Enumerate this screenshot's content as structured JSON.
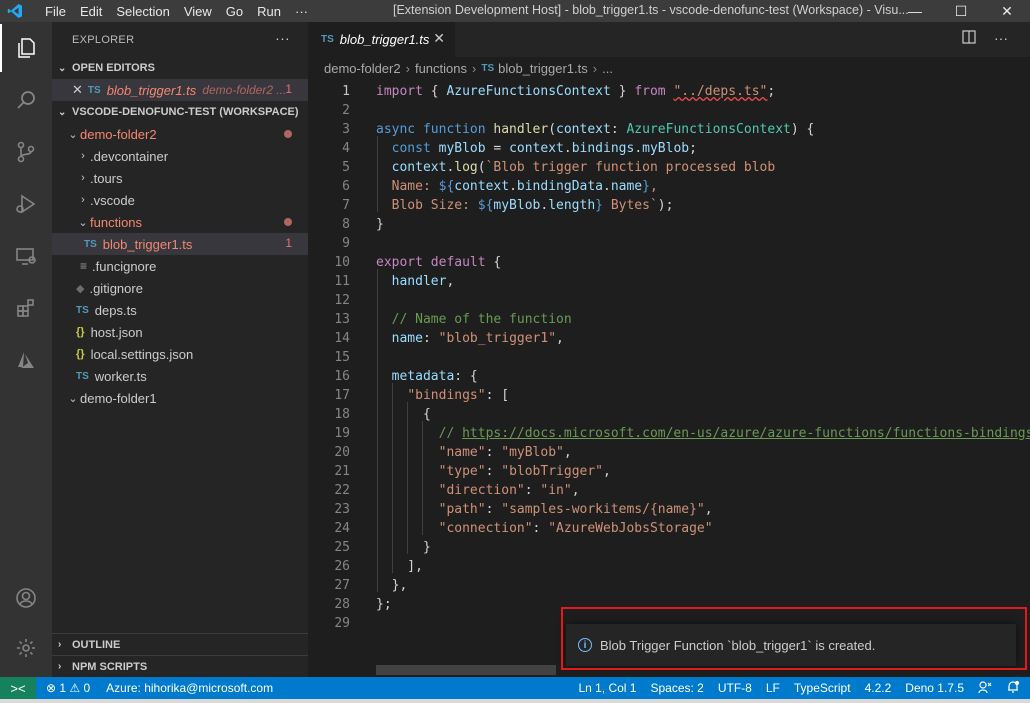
{
  "titlebar": {
    "menu": [
      "File",
      "Edit",
      "Selection",
      "View",
      "Go",
      "Run",
      "···"
    ],
    "window_title": "[Extension Development Host] - blob_trigger1.ts - vscode-denofunc-test (Workspace) - Visu...",
    "minimize": "—",
    "maximize": "☐",
    "close": "✕"
  },
  "sidebar": {
    "title": "EXPLORER",
    "more": "···",
    "open_editors_label": "OPEN EDITORS",
    "open_editor": {
      "name": "blob_trigger1.ts",
      "folder": "demo-folder2 ...",
      "badge": "1"
    },
    "workspace_label": "VSCODE-DENOFUNC-TEST (WORKSPACE)",
    "tree": {
      "demo_folder2": "demo-folder2",
      "devcontainer": ".devcontainer",
      "tours": ".tours",
      "vscode": ".vscode",
      "functions": "functions",
      "blob_trigger": "blob_trigger1.ts",
      "blob_badge": "1",
      "funcignore": ".funcignore",
      "gitignore": ".gitignore",
      "deps": "deps.ts",
      "host": "host.json",
      "local_settings": "local.settings.json",
      "worker": "worker.ts",
      "demo_folder1": "demo-folder1"
    },
    "outline_label": "OUTLINE",
    "npm_label": "NPM SCRIPTS",
    "file_tag": "TS",
    "json_tag": "{}"
  },
  "tabs": {
    "active": "blob_trigger1.ts",
    "close": "✕",
    "tag": "TS"
  },
  "breadcrumb": [
    "demo-folder2",
    "functions",
    "blob_trigger1.ts",
    "..."
  ],
  "editor": {
    "line_numbers": [
      "1",
      "2",
      "3",
      "4",
      "5",
      "6",
      "7",
      "8",
      "9",
      "10",
      "11",
      "12",
      "13",
      "14",
      "15",
      "16",
      "17",
      "18",
      "19",
      "20",
      "21",
      "22",
      "23",
      "24",
      "25",
      "26",
      "27",
      "28",
      "29"
    ]
  },
  "notification": {
    "message": "Blob Trigger Function `blob_trigger1` is created.",
    "icon": "i"
  },
  "statusbar": {
    "remote": "><",
    "problems": "⊗ 1 ⚠ 0",
    "azure": "Azure: hihorika@microsoft.com",
    "position": "Ln 1, Col 1",
    "spaces": "Spaces: 2",
    "encoding": "UTF-8",
    "eol": "LF",
    "language": "TypeScript",
    "version": "4.2.2",
    "deno": "Deno 1.7.5"
  },
  "colors": {
    "accent": "#007acc",
    "highlight_border": "#e01b1b",
    "remote": "#16825d"
  }
}
